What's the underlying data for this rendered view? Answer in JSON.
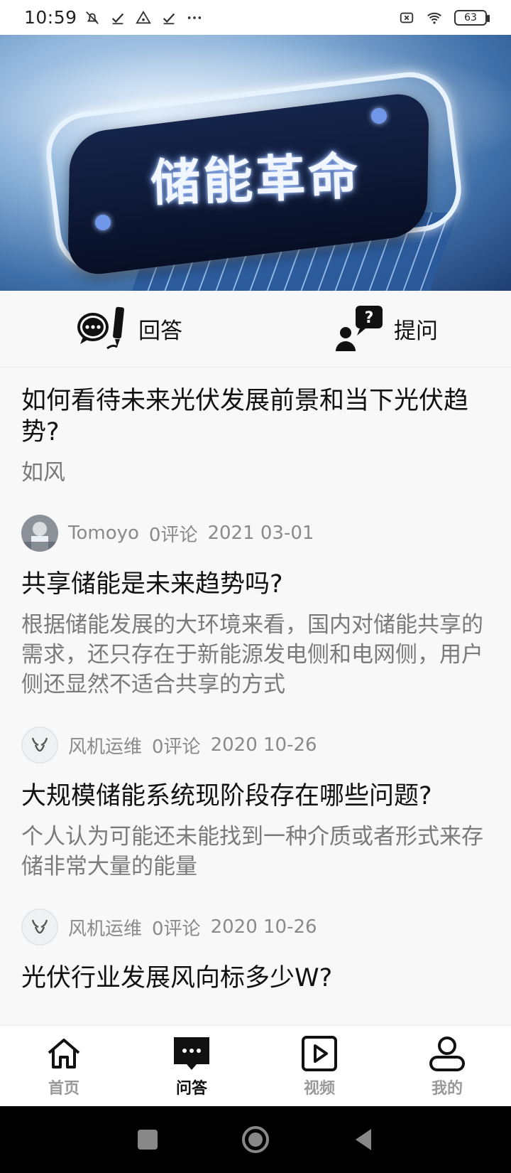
{
  "status_bar": {
    "time": "10:59",
    "battery": "63"
  },
  "banner": {
    "title": "储能革命"
  },
  "actions": {
    "answer_label": "回答",
    "ask_label": "提问"
  },
  "feed": [
    {
      "title": "如何看待未来光伏发展前景和当下光伏趋势?",
      "body": "如风",
      "author": "Tomoyo",
      "comments": "0评论",
      "date": "2021 03-01"
    },
    {
      "title": "共享储能是未来趋势吗?",
      "body": "根据储能发展的大环境来看，国内对储能共享的需求，还只存在于新能源发电侧和电网侧，用户侧还显然不适合共享的方式",
      "author": "风机运维",
      "comments": "0评论",
      "date": "2020 10-26"
    },
    {
      "title": "大规模储能系统现阶段存在哪些问题?",
      "body": "个人认为可能还未能找到一种介质或者形式来存储非常大量的能量",
      "author": "风机运维",
      "comments": "0评论",
      "date": "2020 10-26"
    },
    {
      "title": "光伏行业发展风向标多少W?"
    }
  ],
  "tabs": [
    {
      "label": "首页",
      "icon": "home-icon",
      "active": false
    },
    {
      "label": "问答",
      "icon": "chat-icon",
      "active": true
    },
    {
      "label": "视频",
      "icon": "video-icon",
      "active": false
    },
    {
      "label": "我的",
      "icon": "profile-icon",
      "active": false
    }
  ]
}
